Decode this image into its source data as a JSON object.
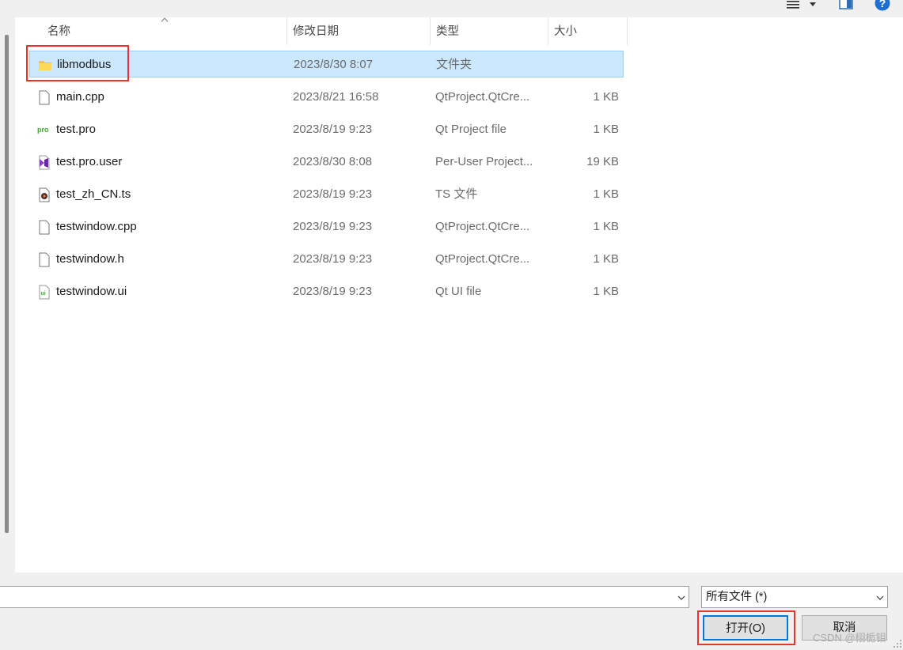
{
  "toolbar": {
    "view_icon": "view-list-icon",
    "view_dropdown_icon": "chevron-down-icon",
    "preview_pane_icon": "preview-pane-icon",
    "help_icon": "help-icon"
  },
  "columns": {
    "name": "名称",
    "date": "修改日期",
    "type": "类型",
    "size": "大小"
  },
  "files": [
    {
      "name": "libmodbus",
      "date": "2023/8/30 8:07",
      "type": "文件夹",
      "size": "",
      "icon": "folder-icon",
      "selected": true
    },
    {
      "name": "main.cpp",
      "date": "2023/8/21 16:58",
      "type": "QtProject.QtCre...",
      "size": "1 KB",
      "icon": "file-icon"
    },
    {
      "name": "test.pro",
      "date": "2023/8/19 9:23",
      "type": "Qt Project file",
      "size": "1 KB",
      "icon": "qt-pro-file-icon"
    },
    {
      "name": "test.pro.user",
      "date": "2023/8/30 8:08",
      "type": "Per-User Project...",
      "size": "19 KB",
      "icon": "visual-studio-file-icon"
    },
    {
      "name": "test_zh_CN.ts",
      "date": "2023/8/19 9:23",
      "type": "TS 文件",
      "size": "1 KB",
      "icon": "media-file-icon"
    },
    {
      "name": "testwindow.cpp",
      "date": "2023/8/19 9:23",
      "type": "QtProject.QtCre...",
      "size": "1 KB",
      "icon": "file-icon"
    },
    {
      "name": "testwindow.h",
      "date": "2023/8/19 9:23",
      "type": "QtProject.QtCre...",
      "size": "1 KB",
      "icon": "file-icon"
    },
    {
      "name": "testwindow.ui",
      "date": "2023/8/19 9:23",
      "type": "Qt UI file",
      "size": "1 KB",
      "icon": "qt-ui-file-icon"
    }
  ],
  "bottom": {
    "filename_value": "",
    "filetype_selected": "所有文件 (*)",
    "open_label": "打开(O)",
    "cancel_label": "取消",
    "watermark": "CSDN @栩栀钼"
  },
  "colors": {
    "selection_bg": "#cce8ff",
    "selection_border": "#99d1ff",
    "highlight_box": "#e8342e",
    "default_button_border": "#0078d7"
  }
}
